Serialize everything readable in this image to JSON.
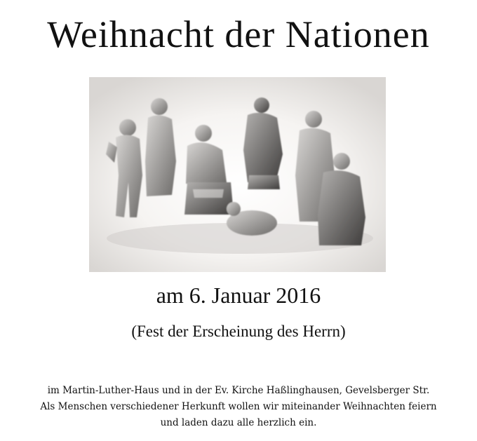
{
  "title": "Weihnacht der Nationen",
  "image": {
    "description_icon": "nativity-figures-photo"
  },
  "date": "am 6. Januar 2016",
  "feast": "(Fest der Erscheinung des Herrn)",
  "body_lines": [
    "im Martin-Luther-Haus und in der Ev. Kirche Haßlinghausen, Gevelsberger Str.",
    "Als Menschen verschiedener Herkunft wollen wir miteinander Weihnachten feiern",
    "und laden dazu alle herzlich ein."
  ]
}
